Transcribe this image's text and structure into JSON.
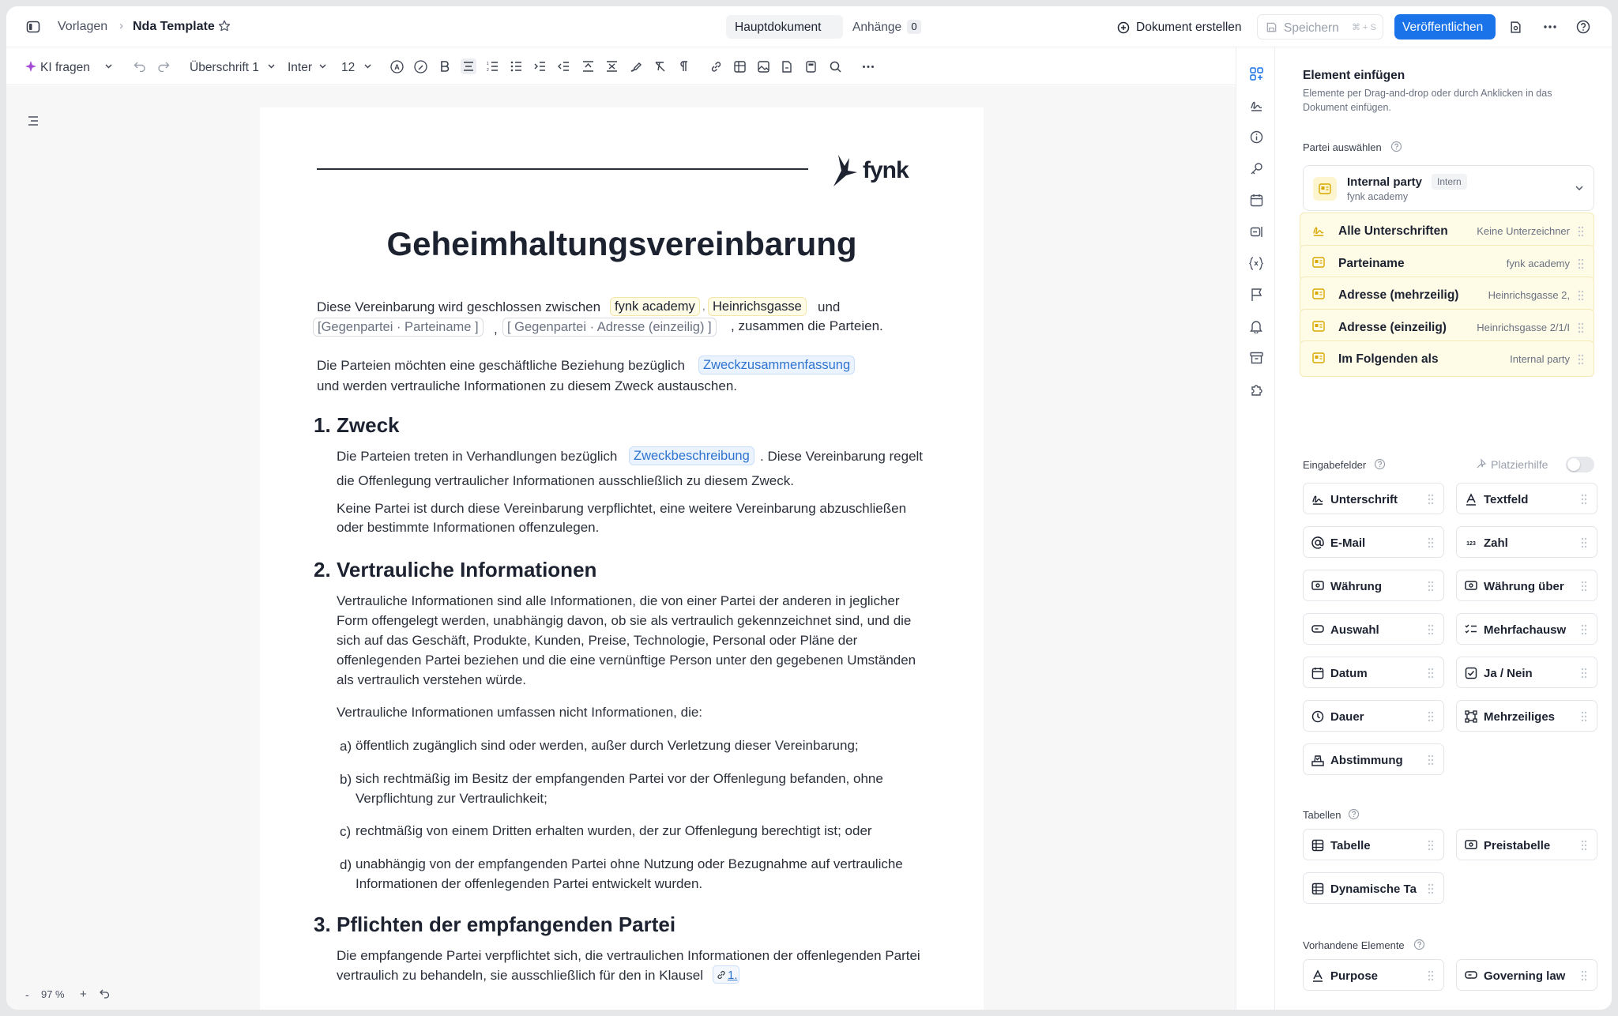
{
  "topbar": {
    "breadcrumb_root": "Vorlagen",
    "breadcrumb_current": "Nda Template",
    "tab_main": "Hauptdokument",
    "tab_attachments": "Anhänge",
    "attachments_count": "0",
    "create_document": "Dokument erstellen",
    "save": "Speichern",
    "save_shortcut": "⌘ + S",
    "publish": "Veröffentlichen"
  },
  "toolbar": {
    "ai": "KI fragen",
    "heading": "Überschrift 1",
    "font": "Inter",
    "size": "12"
  },
  "zoom": {
    "value": "97",
    "unit": "%"
  },
  "document": {
    "logo_text": "fynk",
    "title": "Geheimhaltungsvereinbarung",
    "intro_1": "Diese Vereinbarung wird geschlossen zwischen",
    "party1_name": "fynk academy",
    "party1_address": "Heinrichsgasse",
    "intro_and": "und",
    "party2_name": "[Gegenpartei · Parteiname ]",
    "party2_address": "[ Gegenpartei · Adresse (einzeilig) ]",
    "intro_2": ", zusammen die Parteien.",
    "purpose_1": "Die Parteien möchten eine geschäftliche Beziehung bezüglich",
    "purpose_pill": "Zweckzusammenfassung",
    "purpose_2": "und werden  vertrauliche Informationen zu diesem Zweck austauschen.",
    "s1_num": "1.",
    "s1_title": "Zweck",
    "s1_p1a": "Die Parteien treten in Verhandlungen bezüglich",
    "s1_pill": "Zweckbeschreibung",
    "s1_p1b": ". Diese Vereinbarung regelt",
    "s1_p1c": "die Offenlegung vertraulicher Informationen ausschließlich zu diesem Zweck.",
    "s1_p2a": "Keine Partei ist durch diese Vereinbarung verpflichtet, eine weitere Vereinbarung abzuschließen",
    "s1_p2b": "oder bestimmte Informationen offenzulegen.",
    "s2_num": "2.",
    "s2_title": "Vertrauliche Informationen",
    "s2_p1": [
      "Vertrauliche Informationen sind alle Informationen, die von einer Partei der anderen in jeglicher",
      "Form offengelegt werden, unabhängig davon, ob sie als vertraulich gekennzeichnet sind, und die",
      "sich auf das Geschäft, Produkte, Kunden, Preise, Technologie, Personal oder Pläne der",
      "offenlegenden Partei beziehen und die eine vernünftige Person unter den gegebenen Umständen",
      "als vertraulich verstehen würde."
    ],
    "s2_p2": "Vertrauliche Informationen umfassen nicht Informationen, die:",
    "list": [
      {
        "marker": "a)",
        "lines": [
          "öffentlich zugänglich sind oder werden, außer durch Verletzung dieser Vereinbarung;"
        ]
      },
      {
        "marker": "b)",
        "lines": [
          "sich rechtmäßig im Besitz der empfangenden Partei vor der Offenlegung befanden, ohne",
          "Verpflichtung zur Vertraulichkeit;"
        ]
      },
      {
        "marker": "c)",
        "lines": [
          "rechtmäßig von einem Dritten erhalten wurden, der zur Offenlegung berechtigt ist; oder"
        ]
      },
      {
        "marker": "d)",
        "lines": [
          "unabhängig von der empfangenden Partei ohne Nutzung oder Bezugnahme auf vertrauliche",
          "Informationen der offenlegenden Partei entwickelt wurden."
        ]
      }
    ],
    "s3_num": "3.",
    "s3_title": "Pflichten der empfangenden Partei",
    "s3_p1a": "Die empfangende Partei verpflichtet sich, die vertraulichen Informationen der offenlegenden Partei",
    "s3_p1b": "vertraulich zu behandeln, sie ausschließlich für den in Klausel",
    "s3_ref": "1."
  },
  "panel": {
    "title": "Element einfügen",
    "subtitle_1": "Elemente per Drag-and-drop oder durch Anklicken in das",
    "subtitle_2": "Dokument einfügen.",
    "party_label": "Partei auswählen",
    "party_name": "Internal party",
    "party_badge": "Intern",
    "party_sub": "fynk academy",
    "party_fields": [
      {
        "name": "Alle Unterschriften",
        "value": "Keine Unterzeichner",
        "icon": "signature-icon"
      },
      {
        "name": "Parteiname",
        "value": "fynk academy",
        "icon": "id-card-icon"
      },
      {
        "name": "Adresse (mehrzeilig)",
        "value": "Heinrichsgasse 2,",
        "icon": "id-card-icon"
      },
      {
        "name": "Adresse (einzeilig)",
        "value": "Heinrichsgasse 2/1/I",
        "icon": "id-card-icon"
      },
      {
        "name": "Im Folgenden als",
        "value": "Internal party",
        "icon": "id-card-icon"
      }
    ],
    "inputs_label": "Eingabefelder",
    "placement_help": "Platzierhilfe",
    "inputs": [
      {
        "name": "Unterschrift",
        "icon": "signature-icon"
      },
      {
        "name": "Textfeld",
        "icon": "text-icon"
      },
      {
        "name": "E-Mail",
        "icon": "at-icon"
      },
      {
        "name": "Zahl",
        "icon": "number-icon"
      },
      {
        "name": "Währung",
        "icon": "currency-icon"
      },
      {
        "name": "Währung über",
        "icon": "currency-icon"
      },
      {
        "name": "Auswahl",
        "icon": "select-icon"
      },
      {
        "name": "Mehrfachausw",
        "icon": "multiselect-icon"
      },
      {
        "name": "Datum",
        "icon": "calendar-icon"
      },
      {
        "name": "Ja / Nein",
        "icon": "checkbox-icon"
      },
      {
        "name": "Dauer",
        "icon": "clock-icon"
      },
      {
        "name": "Mehrzeiliges",
        "icon": "multiline-icon"
      },
      {
        "name": "Abstimmung",
        "icon": "vote-icon"
      }
    ],
    "tables_label": "Tabellen",
    "tables": [
      {
        "name": "Tabelle",
        "icon": "table-icon"
      },
      {
        "name": "Preistabelle",
        "icon": "price-table-icon"
      },
      {
        "name": "Dynamische Ta",
        "icon": "table-icon"
      }
    ],
    "existing_label": "Vorhandene Elemente",
    "existing": [
      {
        "name": "Purpose",
        "icon": "text-icon"
      },
      {
        "name": "Governing law",
        "icon": "select-icon"
      }
    ]
  }
}
